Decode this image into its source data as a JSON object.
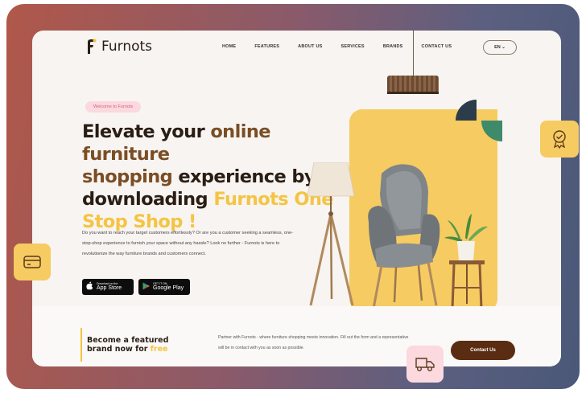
{
  "brand": {
    "name": "Furnots"
  },
  "nav": {
    "items": [
      "HOME",
      "FEATURES",
      "ABOUT US",
      "SERVICES",
      "BRANDS",
      "CONTACT US"
    ],
    "lang": "EN ⌄"
  },
  "hero": {
    "badge": "Welcome to Furnots",
    "headline": {
      "p1": "Elevate your ",
      "p2": "online furniture",
      "p3": "shopping",
      "p4": " experience by downloading ",
      "p5": "Furnots One Stop Shop !"
    },
    "description": "Do you want to reach your target customers effortlessly? Or are you a customer seeking a seamless, one-stop-shop experience to furnish your space without any hassle? Look no further - Furnots is here to revolutionize the way furniture brands and customers connect.",
    "app_store": {
      "small": "Download on the",
      "big": "App Store"
    },
    "google_play": {
      "small": "GET IT ON",
      "big": "Google Play"
    }
  },
  "featured": {
    "title_main": "Become a featured brand now for ",
    "title_free": "free",
    "partner_text": "Partner with Furnots - where furniture shopping meets innovation. Fill out the form and a representative will be in contact with you as soon as possible.",
    "contact_button": "Contact Us"
  },
  "icons": [
    "award-icon",
    "wallet-icon",
    "truck-icon",
    "apple-icon",
    "google-play-icon"
  ],
  "colors": {
    "accent_yellow": "#f6cb62",
    "brown": "#7a4e25",
    "dark": "#2a1d14",
    "pink": "#fbd9df",
    "button": "#5a2c12"
  }
}
